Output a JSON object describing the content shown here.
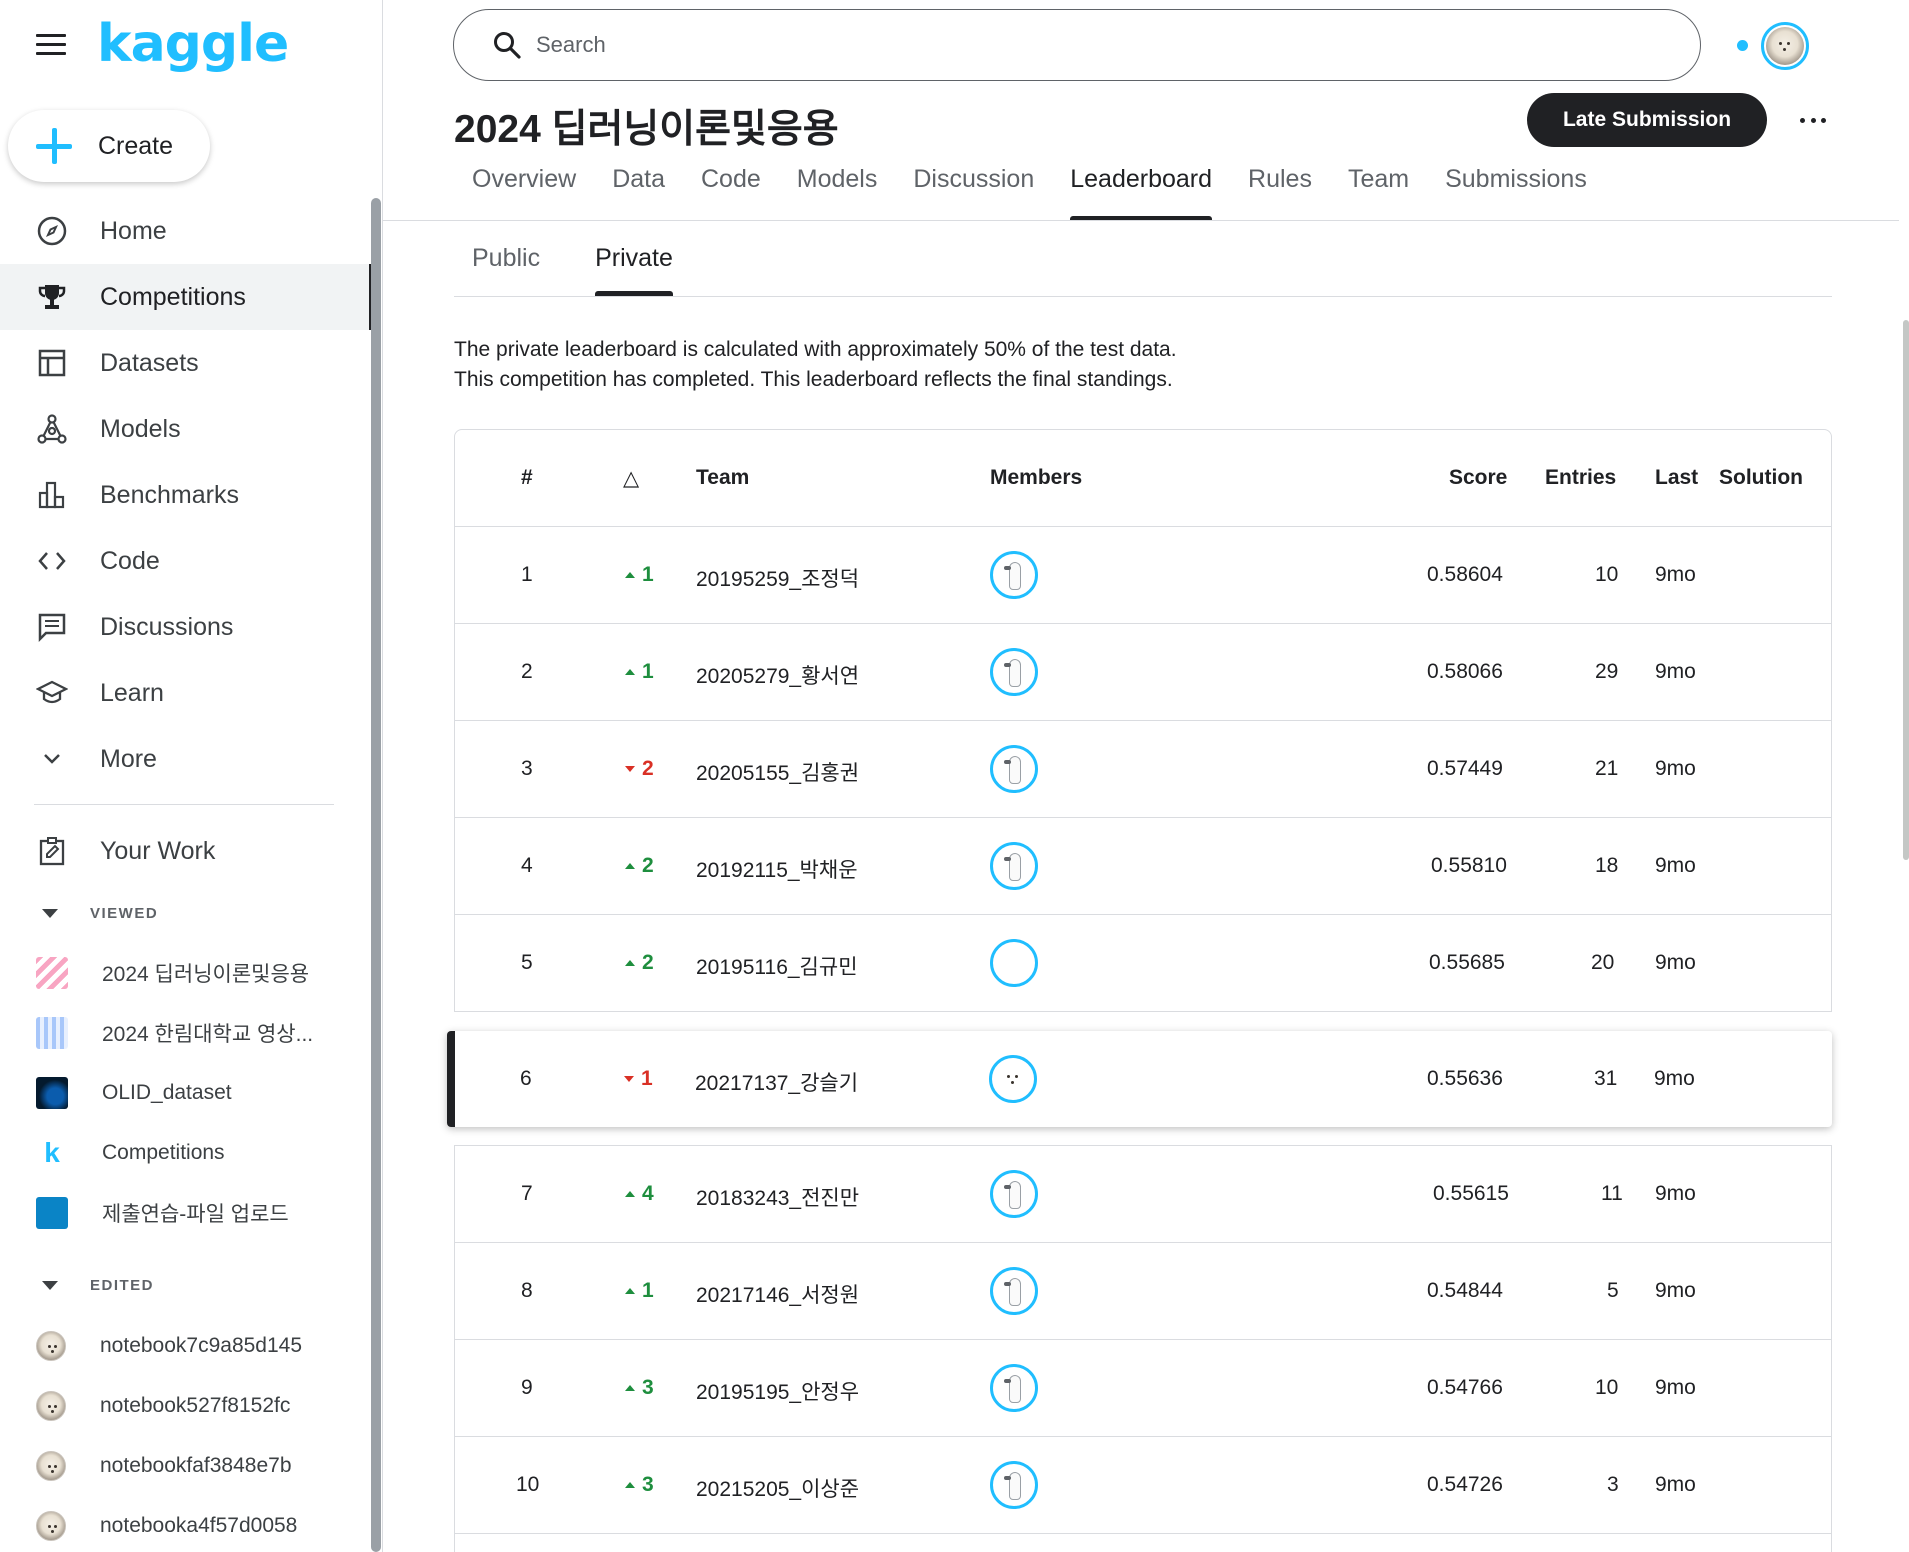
{
  "sidebar": {
    "logo": "kaggle",
    "create_label": "Create",
    "nav": [
      {
        "label": "Home",
        "icon": "compass-icon"
      },
      {
        "label": "Competitions",
        "icon": "trophy-icon",
        "active": true
      },
      {
        "label": "Datasets",
        "icon": "table-icon"
      },
      {
        "label": "Models",
        "icon": "models-icon"
      },
      {
        "label": "Benchmarks",
        "icon": "bar-chart-icon"
      },
      {
        "label": "Code",
        "icon": "code-icon"
      },
      {
        "label": "Discussions",
        "icon": "comment-icon"
      },
      {
        "label": "Learn",
        "icon": "school-icon"
      },
      {
        "label": "More",
        "icon": "chevron-down-icon"
      }
    ],
    "your_work": "Your Work",
    "viewed_title": "VIEWED",
    "viewed": [
      "2024 딥러닝이론및응용",
      "2024 한림대학교 영상...",
      "OLID_dataset",
      "Competitions",
      "제출연습-파일 업로드"
    ],
    "edited_title": "EDITED",
    "edited": [
      "notebook7c9a85d145",
      "notebook527f8152fc",
      "notebookfaf3848e7b",
      "notebooka4f57d0058"
    ]
  },
  "search": {
    "placeholder": "Search"
  },
  "competition": {
    "title": "2024 딥러닝이론및응용",
    "late_submission": "Late Submission"
  },
  "tabs": [
    "Overview",
    "Data",
    "Code",
    "Models",
    "Discussion",
    "Leaderboard",
    "Rules",
    "Team",
    "Submissions"
  ],
  "active_tab": "Leaderboard",
  "subtabs": [
    "Public",
    "Private"
  ],
  "active_subtab": "Private",
  "info": {
    "line1": "The private leaderboard is calculated with approximately 50% of the test data.",
    "line2": "This competition has completed. This leaderboard reflects the final standings."
  },
  "table": {
    "headers": {
      "rank": "#",
      "delta": "△",
      "team": "Team",
      "members": "Members",
      "score": "Score",
      "entries": "Entries",
      "last": "Last",
      "solution": "Solution"
    },
    "rows": [
      {
        "rank": "1",
        "dir": "up",
        "delta": "1",
        "team": "20195259_조정덕",
        "avatar": "goose",
        "score": "0.58604",
        "entries": "10",
        "last": "9mo"
      },
      {
        "rank": "2",
        "dir": "up",
        "delta": "1",
        "team": "20205279_황서연",
        "avatar": "goose",
        "score": "0.58066",
        "entries": "29",
        "last": "9mo"
      },
      {
        "rank": "3",
        "dir": "down",
        "delta": "2",
        "team": "20205155_김홍권",
        "avatar": "goose",
        "score": "0.57449",
        "entries": "21",
        "last": "9mo"
      },
      {
        "rank": "4",
        "dir": "up",
        "delta": "2",
        "team": "20192115_박채운",
        "avatar": "goose",
        "score": "0.55810",
        "entries": "18",
        "last": "9mo"
      },
      {
        "rank": "5",
        "dir": "up",
        "delta": "2",
        "team": "20195116_김규민",
        "avatar": "brain",
        "score": "0.55685",
        "entries": "20",
        "last": "9mo"
      },
      {
        "rank": "6",
        "dir": "down",
        "delta": "1",
        "team": "20217137_강슬기",
        "avatar": "dog",
        "score": "0.55636",
        "entries": "31",
        "last": "9mo",
        "highlight": true
      },
      {
        "rank": "7",
        "dir": "up",
        "delta": "4",
        "team": "20183243_전진만",
        "avatar": "goose",
        "score": "0.55615",
        "entries": "11",
        "last": "9mo"
      },
      {
        "rank": "8",
        "dir": "up",
        "delta": "1",
        "team": "20217146_서정원",
        "avatar": "goose",
        "score": "0.54844",
        "entries": "5",
        "last": "9mo"
      },
      {
        "rank": "9",
        "dir": "up",
        "delta": "3",
        "team": "20195195_안정우",
        "avatar": "goose",
        "score": "0.54766",
        "entries": "10",
        "last": "9mo"
      },
      {
        "rank": "10",
        "dir": "up",
        "delta": "3",
        "team": "20215205_이상준",
        "avatar": "goose",
        "score": "0.54726",
        "entries": "3",
        "last": "9mo"
      }
    ]
  },
  "colors": {
    "accent": "#20beff",
    "up": "#1e8e3e",
    "down": "#d93025",
    "dark": "#202124"
  }
}
